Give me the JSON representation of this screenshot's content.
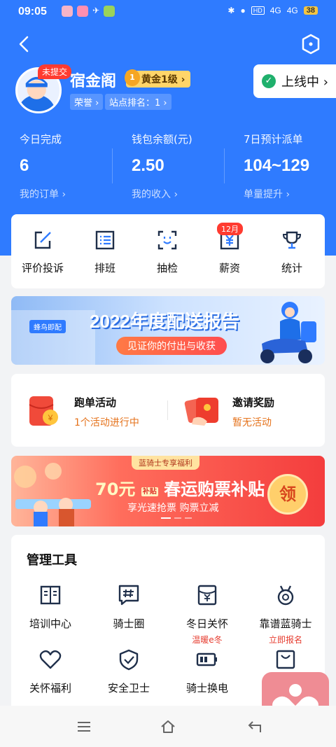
{
  "status_bar": {
    "time": "09:05",
    "network1": "4G",
    "network2": "4G",
    "battery": "38",
    "hd": "HD"
  },
  "profile": {
    "unsubmitted_badge": "未提交",
    "name": "宿金阁",
    "level": "黄金1级 ›",
    "level_medal": "1",
    "honor_tag": "荣誉 ›",
    "rank_tag": "站点排名：1 ›",
    "online_status": "上线中 ›"
  },
  "stats": [
    {
      "label": "今日完成",
      "value": "6",
      "link": "我的订单 ›"
    },
    {
      "label": "钱包余额(元)",
      "value": "2.50",
      "link": "我的收入 ›"
    },
    {
      "label": "7日预计派单",
      "value": "104~129",
      "link": "单量提升 ›"
    }
  ],
  "quick_actions": [
    {
      "label": "评价投诉",
      "icon": "edit-icon"
    },
    {
      "label": "排班",
      "icon": "list-icon"
    },
    {
      "label": "抽检",
      "icon": "face-scan-icon"
    },
    {
      "label": "薪资",
      "icon": "yen-icon",
      "badge": "12月"
    },
    {
      "label": "统计",
      "icon": "trophy-icon"
    }
  ],
  "banner_report": {
    "title": "2022年度配送报告",
    "subtitle": "见证你的付出与收获",
    "logo_text": "蜂鸟即配"
  },
  "activities": [
    {
      "title": "跑单活动",
      "status": "1个活动进行中"
    },
    {
      "title": "邀请奖励",
      "status": "暂无活动"
    }
  ],
  "ticket_banner": {
    "top_tag": "蓝骑士专享福利",
    "amount": "70元",
    "chip": "补贴",
    "title": "春运购票补贴",
    "subtitle": "享光速抢票 购票立减",
    "button": "领"
  },
  "tools": {
    "title": "管理工具",
    "items": [
      {
        "label": "培训中心",
        "icon": "book-icon",
        "sub": ""
      },
      {
        "label": "骑士圈",
        "icon": "hash-chat-icon",
        "sub": ""
      },
      {
        "label": "冬日关怀",
        "icon": "envelope-yen-icon",
        "sub": "温暖e冬"
      },
      {
        "label": "靠谱蓝骑士",
        "icon": "medal-icon",
        "sub": "立即报名"
      },
      {
        "label": "关怀福利",
        "icon": "heart-icon",
        "sub": ""
      },
      {
        "label": "安全卫士",
        "icon": "shield-check-icon",
        "sub": ""
      },
      {
        "label": "骑士换电",
        "icon": "battery-icon",
        "sub": ""
      },
      {
        "label": "",
        "icon": "bag-icon",
        "sub": ""
      }
    ]
  },
  "colors": {
    "brand_blue": "#2f7bff",
    "accent_orange": "#e5721b",
    "red": "#ff3b30"
  }
}
